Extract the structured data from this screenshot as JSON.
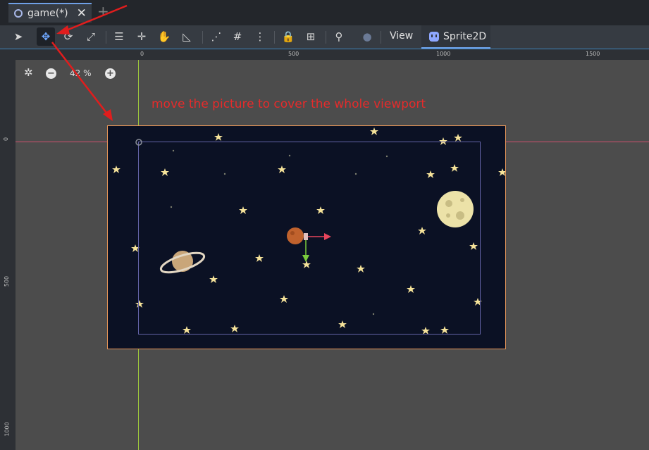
{
  "tabbar": {
    "tab_title": "game(*)",
    "close_glyph": "✕",
    "add_glyph": "+"
  },
  "toolbar": {
    "tools": [
      {
        "name": "select-tool",
        "icon": "arrow-pointer-icon",
        "glyph": "➤"
      },
      {
        "name": "move-tool",
        "icon": "move-arrows-icon",
        "glyph": "✥",
        "active": true
      },
      {
        "name": "rotate-tool",
        "icon": "rotate-icon",
        "glyph": "⟳"
      },
      {
        "name": "scale-tool",
        "icon": "scale-icon",
        "glyph": "⤢"
      },
      {
        "name": "list-select-tool",
        "icon": "list-select-icon",
        "glyph": "☰"
      },
      {
        "name": "pivot-tool",
        "icon": "pivot-icon",
        "glyph": "✛"
      },
      {
        "name": "pan-tool",
        "icon": "hand-icon",
        "glyph": "✋"
      },
      {
        "name": "ruler-tool",
        "icon": "ruler-icon",
        "glyph": "◺"
      },
      {
        "name": "smart-snap-toggle",
        "icon": "snap-icon",
        "glyph": "⋰"
      },
      {
        "name": "grid-snap-toggle",
        "icon": "grid-icon",
        "glyph": "#"
      },
      {
        "name": "snap-options-menu",
        "icon": "kebab-icon",
        "glyph": "⋮"
      },
      {
        "name": "lock-button",
        "icon": "lock-icon",
        "glyph": "🔒"
      },
      {
        "name": "group-button",
        "icon": "group-icon",
        "glyph": "⊞"
      },
      {
        "name": "skeleton-button",
        "icon": "bone-icon",
        "glyph": "⚲"
      },
      {
        "name": "camera-override-button",
        "icon": "camera-icon",
        "glyph": "●"
      }
    ],
    "view_label": "View",
    "sprite_tab_label": "Sprite2D"
  },
  "rulers": {
    "h_labels": [
      "0",
      "500",
      "1000",
      "1500"
    ],
    "v_labels": [
      "0",
      "500",
      "1000"
    ]
  },
  "zoom": {
    "value": "42 %",
    "minus": "−",
    "plus": "+"
  },
  "annotation": {
    "text": "move the picture to cover the whole viewport"
  },
  "colors": {
    "frame_border": "#e89658",
    "annotation": "#e52b2b",
    "accent": "#6fa0e6"
  }
}
